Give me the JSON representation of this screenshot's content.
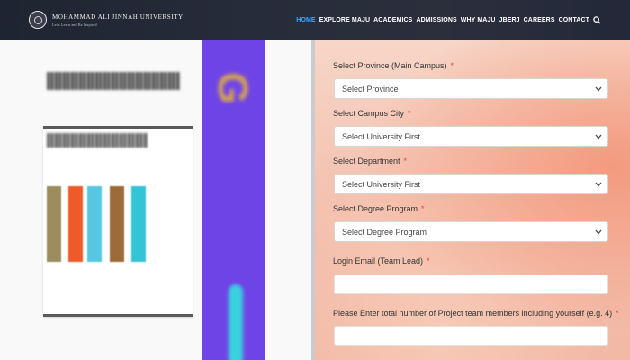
{
  "header": {
    "logo_title": "MOHAMMAD ALI JINNAH UNIVERSITY",
    "logo_subtitle": "Let's Learn and Be Inspired",
    "nav": [
      {
        "label": "HOME",
        "active": true
      },
      {
        "label": "EXPLORE MAJU",
        "active": false
      },
      {
        "label": "ACADEMICS",
        "active": false
      },
      {
        "label": "ADMISSIONS",
        "active": false
      },
      {
        "label": "WHY MAJU",
        "active": false
      },
      {
        "label": "JBERJ",
        "active": false
      },
      {
        "label": "CAREERS",
        "active": false
      },
      {
        "label": "CONTACT",
        "active": false
      }
    ],
    "search_icon": "search-icon"
  },
  "form": {
    "province": {
      "label": "Select Province (Main Campus)",
      "value": "Select Province"
    },
    "campus_city": {
      "label": "Select Campus City",
      "value": "Select University First"
    },
    "department": {
      "label": "Select Department",
      "value": "Select University First"
    },
    "degree_program": {
      "label": "Select Degree Program",
      "value": "Select Degree Program"
    },
    "login_email": {
      "label": "Login Email (Team Lead)",
      "value": ""
    },
    "team_members": {
      "label": "Please Enter total number of Project team members including yourself (e.g. 4)",
      "value": ""
    },
    "required_mark": "*"
  },
  "colors": {
    "accent": "#3ea8ff",
    "required": "#e24040",
    "purple_panel": "#6f44e6"
  }
}
